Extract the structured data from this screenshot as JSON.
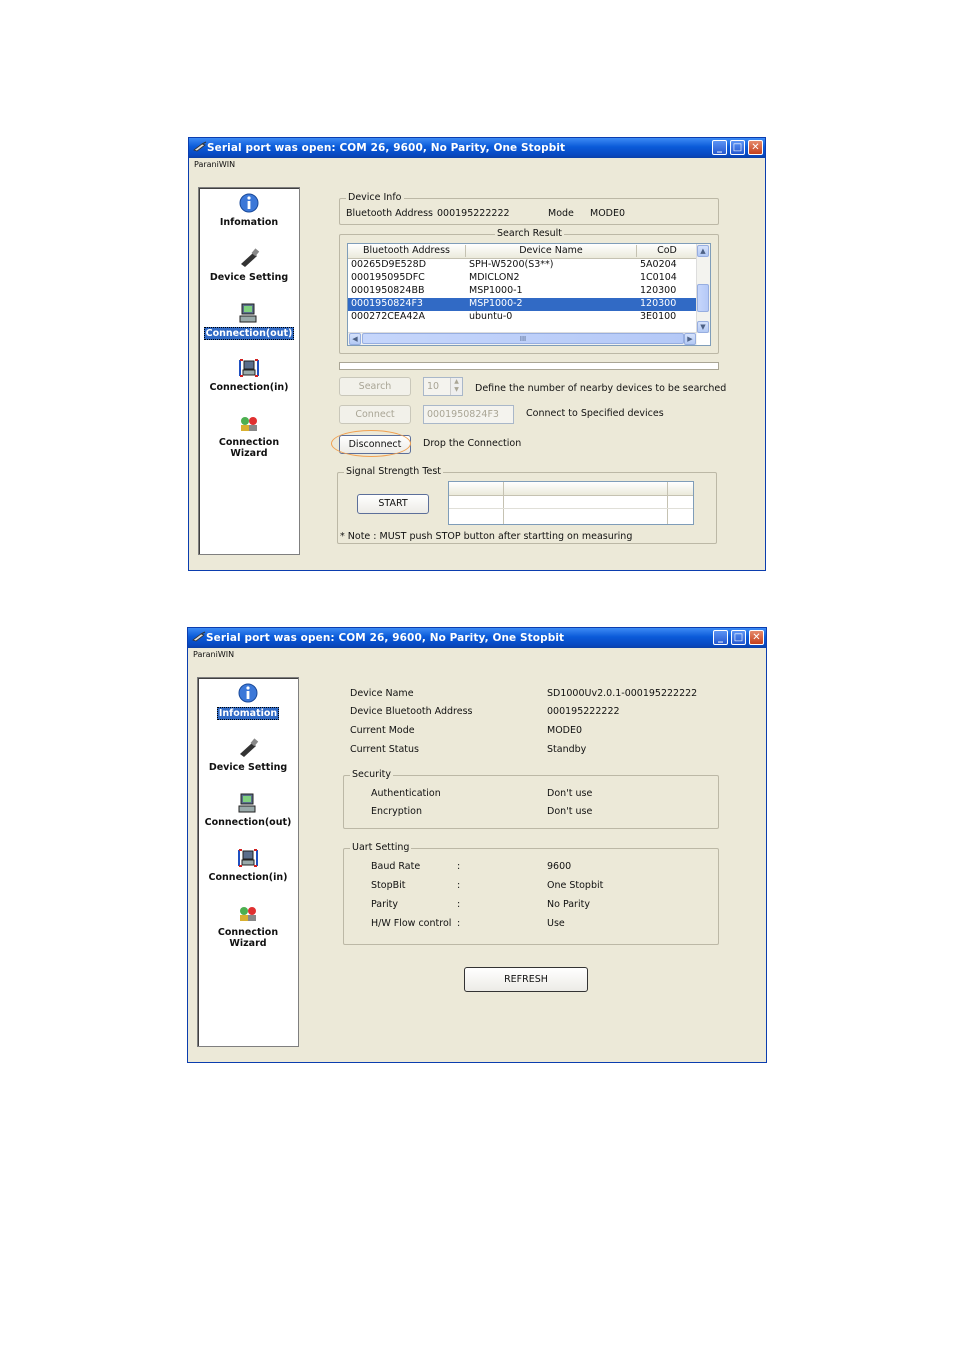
{
  "window1": {
    "title": "Serial port was open: COM 26, 9600, No Parity, One Stopbit",
    "menu": "ParaniWIN",
    "sidebar": [
      {
        "label": "Infomation",
        "icon": "info-icon",
        "selected": false
      },
      {
        "label": "Device Setting",
        "icon": "usb-dongle-icon",
        "selected": false
      },
      {
        "label": "Connection(out)",
        "icon": "computer-out-icon",
        "selected": true
      },
      {
        "label": "Connection(in)",
        "icon": "computer-in-icon",
        "selected": false
      },
      {
        "label": "Connection Wizard",
        "icon": "wizard-icon",
        "selected": false
      }
    ],
    "device_info": {
      "group_title": "Device Info",
      "bt_label": "Bluetooth Address",
      "bt_value": "000195222222",
      "mode_label": "Mode",
      "mode_value": "MODE0"
    },
    "search_result": {
      "group_title": "Search Result",
      "columns": [
        "Bluetooth Address",
        "Device Name",
        "CoD"
      ],
      "rows": [
        {
          "address": "00265D9E528D",
          "name": "SPH-W5200(S3**)",
          "cod": "5A0204",
          "selected": false
        },
        {
          "address": "000195095DFC",
          "name": "MDICLON2",
          "cod": "1C0104",
          "selected": false
        },
        {
          "address": "0001950824BB",
          "name": "MSP1000-1",
          "cod": "120300",
          "selected": false
        },
        {
          "address": "0001950824F3",
          "name": "MSP1000-2",
          "cod": "120300",
          "selected": true
        },
        {
          "address": "000272CEA42A",
          "name": "ubuntu-0",
          "cod": "3E0100",
          "selected": false
        }
      ],
      "scroll_mid_glyph": "III"
    },
    "search_button": "Search",
    "search_count": "10",
    "search_desc": "Define the number of nearby devices to be searched",
    "connect_button": "Connect",
    "connect_value": "0001950824F3",
    "connect_desc": "Connect to Specified devices",
    "disconnect_button": "Disconnect",
    "disconnect_desc": "Drop the Connection",
    "signal_test": {
      "group_title": "Signal Strength Test",
      "start_button": "START",
      "note": "* Note : MUST push STOP button after startting on measuring"
    },
    "highlight_color": "#f0a050"
  },
  "window2": {
    "title": "Serial port was open: COM 26, 9600, No Parity, One Stopbit",
    "menu": "ParaniWIN",
    "sidebar": [
      {
        "label": "Infomation",
        "icon": "info-icon",
        "selected": true
      },
      {
        "label": "Device Setting",
        "icon": "usb-dongle-icon",
        "selected": false
      },
      {
        "label": "Connection(out)",
        "icon": "computer-out-icon",
        "selected": false
      },
      {
        "label": "Connection(in)",
        "icon": "computer-in-icon",
        "selected": false
      },
      {
        "label": "Connection Wizard",
        "icon": "wizard-icon",
        "selected": false
      }
    ],
    "info": [
      {
        "label": "Device Name",
        "value": "SD1000Uv2.0.1-000195222222"
      },
      {
        "label": "Device Bluetooth Address",
        "value": "000195222222"
      },
      {
        "label": "Current Mode",
        "value": "MODE0"
      },
      {
        "label": "Current Status",
        "value": "Standby"
      }
    ],
    "security": {
      "group_title": "Security",
      "rows": [
        {
          "label": "Authentication",
          "value": "Don't use"
        },
        {
          "label": "Encryption",
          "value": "Don't use"
        }
      ]
    },
    "uart": {
      "group_title": "Uart Setting",
      "rows": [
        {
          "label": "Baud Rate",
          "sep": ":",
          "value": "9600"
        },
        {
          "label": "StopBit",
          "sep": ":",
          "value": "One Stopbit"
        },
        {
          "label": "Parity",
          "sep": ":",
          "value": "No Parity"
        },
        {
          "label": "H/W Flow control",
          "sep": ":",
          "value": "Use"
        }
      ]
    },
    "refresh_button": "REFRESH"
  },
  "colors": {
    "titlebar": "#0a5ad8",
    "window_bg": "#ece9d8",
    "selection": "#316ac5"
  }
}
